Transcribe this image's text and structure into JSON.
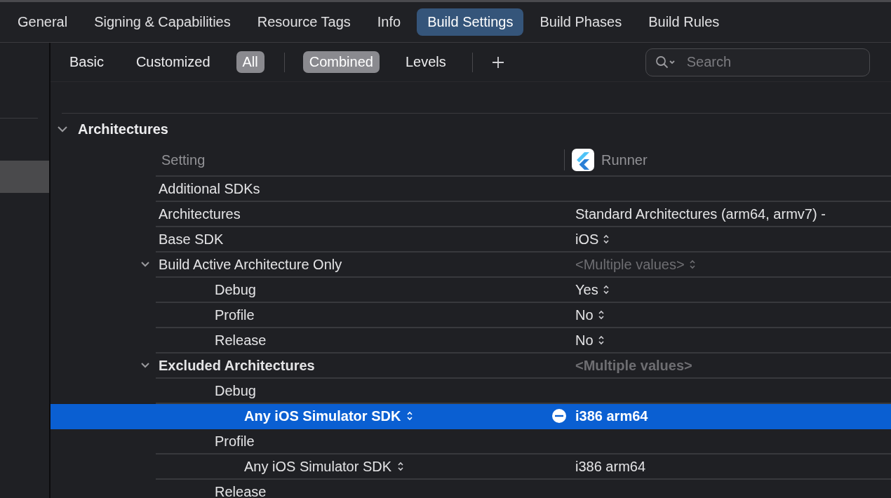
{
  "tabs": [
    {
      "label": "General",
      "selected": false
    },
    {
      "label": "Signing & Capabilities",
      "selected": false
    },
    {
      "label": "Resource Tags",
      "selected": false
    },
    {
      "label": "Info",
      "selected": false
    },
    {
      "label": "Build Settings",
      "selected": true
    },
    {
      "label": "Build Phases",
      "selected": false
    },
    {
      "label": "Build Rules",
      "selected": false
    }
  ],
  "filters": {
    "scope": [
      {
        "label": "Basic",
        "selected": false
      },
      {
        "label": "Customized",
        "selected": false
      },
      {
        "label": "All",
        "selected": true
      }
    ],
    "view": [
      {
        "label": "Combined",
        "selected": true
      },
      {
        "label": "Levels",
        "selected": false
      }
    ]
  },
  "search": {
    "placeholder": "Search"
  },
  "section": {
    "title": "Architectures",
    "expanded": true,
    "columns": {
      "setting": "Setting",
      "target": "Runner"
    },
    "rows": [
      {
        "name": "Additional SDKs",
        "modified": false,
        "selected": false
      },
      {
        "name": "Architectures",
        "value": "Standard Architectures (arm64, armv7)  -",
        "popup": false,
        "muted": false,
        "modified": false,
        "selected": false
      },
      {
        "name": "Base SDK",
        "value": "iOS",
        "popup": true,
        "muted": false,
        "modified": false,
        "selected": false
      },
      {
        "name": "Build Active Architecture Only",
        "value": "<Multiple values>",
        "popup": true,
        "muted": true,
        "modified": false,
        "selected": false,
        "expanded": true,
        "children": [
          {
            "name": "Debug",
            "value": "Yes",
            "popup": true,
            "muted": false,
            "modified": false,
            "selected": false
          },
          {
            "name": "Profile",
            "value": "No",
            "popup": true,
            "muted": false,
            "modified": false,
            "selected": false
          },
          {
            "name": "Release",
            "value": "No",
            "popup": true,
            "muted": false,
            "modified": false,
            "selected": false
          }
        ]
      },
      {
        "name": "Excluded Architectures",
        "value": "<Multiple values>",
        "popup": false,
        "muted": true,
        "modified": true,
        "selected": false,
        "expanded": true,
        "children": [
          {
            "name": "Debug",
            "modified": false,
            "selected": false,
            "children": [
              {
                "name": "Any iOS Simulator SDK",
                "name_popup": true,
                "value": "i386 arm64",
                "popup": false,
                "muted": false,
                "modified": true,
                "selected": true
              }
            ]
          },
          {
            "name": "Profile",
            "modified": false,
            "selected": false,
            "children": [
              {
                "name": "Any iOS Simulator SDK",
                "name_popup": true,
                "value": "i386 arm64",
                "popup": false,
                "muted": false,
                "modified": false,
                "selected": false
              }
            ]
          },
          {
            "name": "Release",
            "modified": false,
            "selected": false
          }
        ]
      }
    ]
  }
}
